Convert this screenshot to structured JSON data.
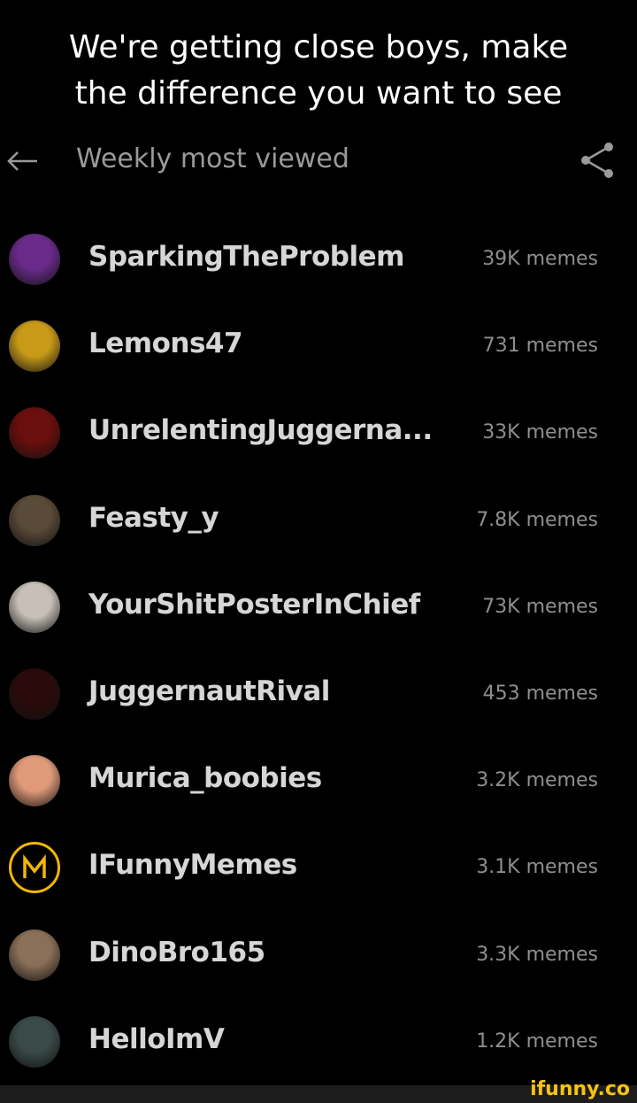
{
  "caption": {
    "line1": "We're getting close boys, make",
    "line2": "the difference you want to see"
  },
  "header": {
    "title": "Weekly most viewed",
    "back_icon": "arrow-left-icon",
    "share_icon": "share-icon"
  },
  "users": [
    {
      "name": "SparkingTheProblem",
      "count": "39K memes",
      "avatar_color": "#6a2a8a"
    },
    {
      "name": "Lemons47",
      "count": "731 memes",
      "avatar_color": "#c89a18"
    },
    {
      "name": "UnrelentingJuggerna...",
      "count": "33K memes",
      "avatar_color": "#6a0e0e"
    },
    {
      "name": "Feasty_y",
      "count": "7.8K memes",
      "avatar_color": "#5a4a38"
    },
    {
      "name": "YourShitPosterInChief",
      "count": "73K memes",
      "avatar_color": "#c8c0b8"
    },
    {
      "name": "JuggernautRival",
      "count": "453 memes",
      "avatar_color": "#2a0a0a"
    },
    {
      "name": "Murica_boobies",
      "count": "3.2K memes",
      "avatar_color": "#e09a7a"
    },
    {
      "name": "IFunnyMemes",
      "count": "3.1K memes",
      "avatar_color": "#f2b705"
    },
    {
      "name": "DinoBro165",
      "count": "3.3K memes",
      "avatar_color": "#8a7058"
    },
    {
      "name": "HelloImV",
      "count": "1.2K memes",
      "avatar_color": "#3a4a48"
    }
  ],
  "footer": {
    "watermark": "ifunny.co"
  }
}
